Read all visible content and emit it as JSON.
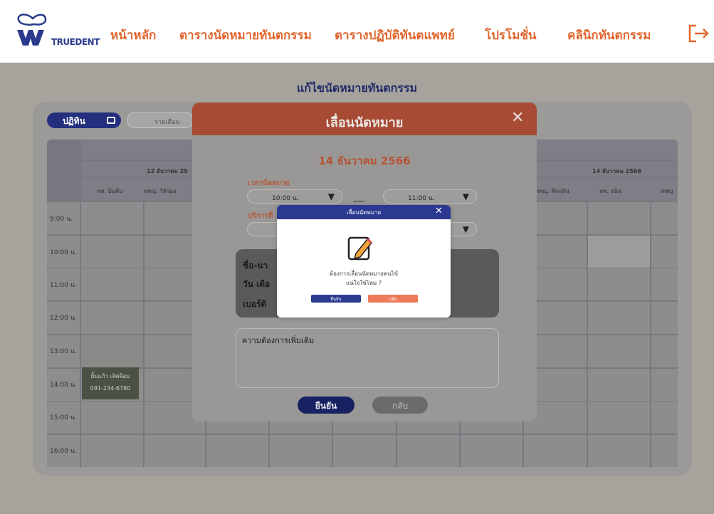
{
  "brand": {
    "name": "TRUEDENT",
    "first_letter": "W"
  },
  "nav": {
    "home": "หน้าหลัก",
    "appointments": "ตารางนัดหมายทันตกรรม",
    "dentist_schedule": "ตารางปฏิบัติทันตแพทย์",
    "promotions": "โปรโมชั่น",
    "clinic": "คลินิกทันตกรรม"
  },
  "page": {
    "title": "แก้ไขนัดหมายทันตกรรม"
  },
  "controls": {
    "mode_button": "ปฏิทิน",
    "search_placeholder": "รายเดือน"
  },
  "schedule": {
    "date_left": "12 ธันวาคม 25",
    "date_right": "14 ธันวาคม 2566",
    "doctors_left": [
      "ทพ. ปิ่นสิน",
      "ทพญ. วิลิร่ออ"
    ],
    "doctors_right": [
      "ทพญ. ศิลกุสิน",
      "ทพ. ธนิช",
      "ทพญ"
    ],
    "times": [
      "9:00 น.",
      "10:00 น.",
      "11:00 น.",
      "12:00 น.",
      "13:00 น.",
      "14:00 น.",
      "15:00 น.",
      "16:00 น."
    ],
    "booked": {
      "name": "ยิ้มแก้ว เลิศล้อม",
      "phone": "091-234-6780"
    }
  },
  "modal": {
    "title": "เลื่อนนัดหมาย",
    "close": "✕",
    "date": "14 ธันวาคม 2566",
    "time_label": "เวลานัดหมาย",
    "start_time": "10:00 น.",
    "end_time": "11:00 น.",
    "service_label": "บริการที่",
    "info_name": "ชื่อ-นา",
    "info_date": "วัน เดือ",
    "info_phone": "เบอร์ติ",
    "notes": "ความต้องการเพิ่มเติม",
    "confirm": "ยืนยัน",
    "back": "กลับ"
  },
  "dialog": {
    "title": "เลื่อนนัดหมาย",
    "close": "✕",
    "message_line1": "ต้องการเลื่อนนัดหมายคนไข้",
    "message_line2": "แน่ใจใช่ไหม ?",
    "yes": "ยืนยัน",
    "no": "กลับ"
  },
  "colors": {
    "navy": "#2b3990",
    "orange": "#e0672f",
    "salmon": "#ef7a5a"
  }
}
